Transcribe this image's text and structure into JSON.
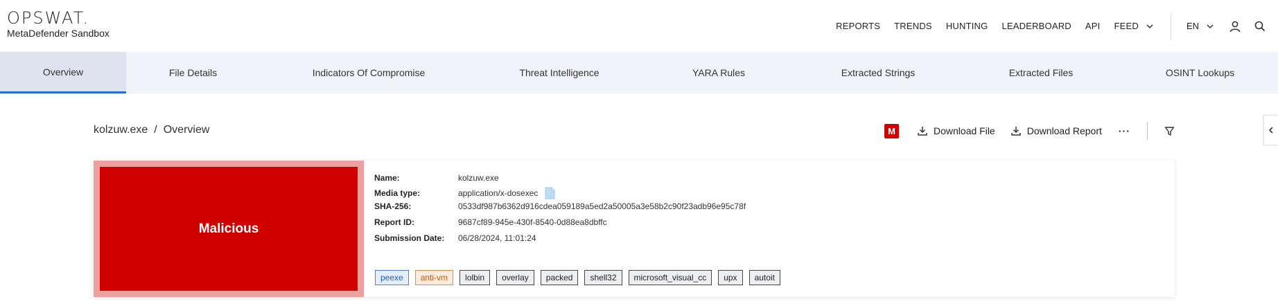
{
  "brand": {
    "logo": "OPSWAT.",
    "product": "MetaDefender Sandbox"
  },
  "nav": {
    "items": [
      "REPORTS",
      "TRENDS",
      "HUNTING",
      "LEADERBOARD",
      "API"
    ],
    "feed_label": "FEED",
    "lang_label": "EN",
    "icons": [
      "user-icon",
      "search-icon"
    ]
  },
  "tabs": [
    {
      "label": "Overview",
      "active": true
    },
    {
      "label": "File Details",
      "active": false
    },
    {
      "label": "Indicators Of Compromise",
      "active": false
    },
    {
      "label": "Threat Intelligence",
      "active": false
    },
    {
      "label": "YARA Rules",
      "active": false
    },
    {
      "label": "Extracted Strings",
      "active": false
    },
    {
      "label": "Extracted Files",
      "active": false
    },
    {
      "label": "OSINT Lookups",
      "active": false
    }
  ],
  "breadcrumb": {
    "file": "kolzuw.exe",
    "separator": "/",
    "page": "Overview"
  },
  "toolbar": {
    "badge": "M",
    "download_file": "Download File",
    "download_report": "Download Report",
    "more": "···"
  },
  "verdict": {
    "label": "Malicious",
    "color": "#d10000"
  },
  "file_info": {
    "name_label": "Name:",
    "name": "kolzuw.exe",
    "media_label": "Media type:",
    "media": "application/x-dosexec",
    "sha_label": "SHA-256:",
    "sha": "0533df987b6362d916cdea059189a5ed2a50005a3e58b2c90f23adb96e95c78f",
    "report_label": "Report ID:",
    "report": "9687cf89-945e-430f-8540-0d88ea8dbffc",
    "date_label": "Submission Date:",
    "date": "06/28/2024, 11:01:24"
  },
  "tags": [
    {
      "label": "peexe",
      "style": "blue"
    },
    {
      "label": "anti-vm",
      "style": "orange"
    },
    {
      "label": "lolbin",
      "style": "default"
    },
    {
      "label": "overlay",
      "style": "default"
    },
    {
      "label": "packed",
      "style": "default"
    },
    {
      "label": "shell32",
      "style": "default"
    },
    {
      "label": "microsoft_visual_cc",
      "style": "default"
    },
    {
      "label": "upx",
      "style": "default"
    },
    {
      "label": "autoit",
      "style": "default"
    }
  ]
}
